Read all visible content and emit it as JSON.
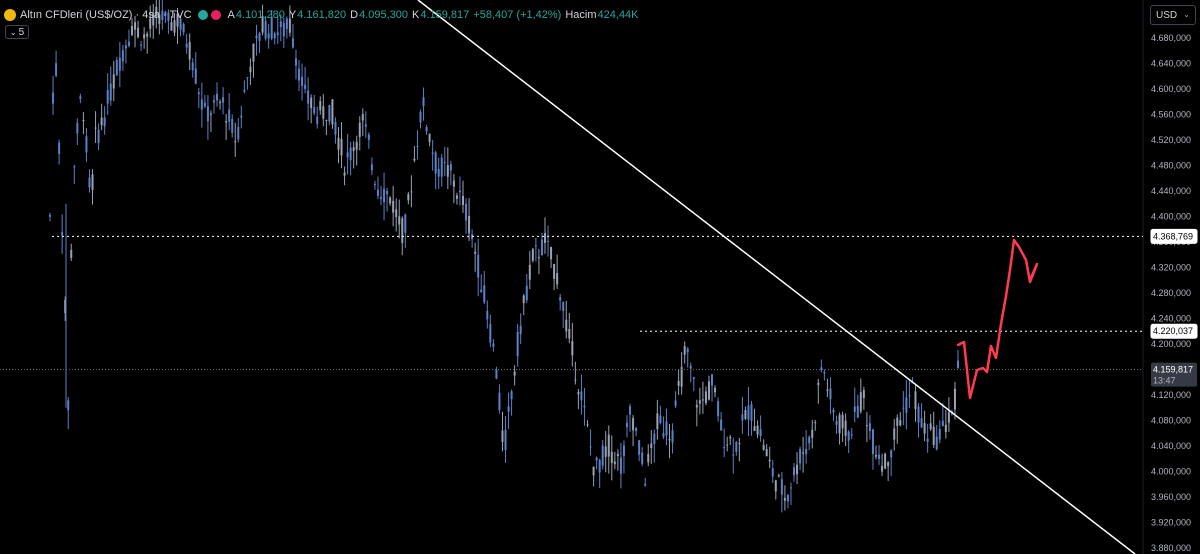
{
  "header": {
    "symbol": "Altın CFDleri (US$/OZ) · 4sa · TVC",
    "open_label": "A",
    "open": "4.101,280",
    "high_label": "Y",
    "high": "4.161,820",
    "low_label": "D",
    "low": "4.095,300",
    "close_label": "K",
    "close": "4.159,817",
    "change": "+58,407 (+1,42%)",
    "volume_label": "Hacim",
    "volume": "424,44K",
    "interval_badge": "5"
  },
  "currency": {
    "label": "USD",
    "chevron": "⌄"
  },
  "colors": {
    "background": "#000000",
    "candle": "#5b82c8",
    "candle_light": "#9aa3b3",
    "trendline": "#ffffff",
    "forecast": "#ff3b4e",
    "positive": "#26a69a"
  },
  "chart_data": {
    "type": "candlestick",
    "ylim": [
      3880,
      4700
    ],
    "y_ticks": [
      "4.680,000",
      "4.640,000",
      "4.600,000",
      "4.560,000",
      "4.520,000",
      "4.480,000",
      "4.440,000",
      "4.400,000",
      "4.360,000",
      "4.320,000",
      "4.280,000",
      "4.240,000",
      "4.200,000",
      "4.160,000",
      "4.120,000",
      "4.080,000",
      "4.040,000",
      "4.000,000",
      "3.960,000",
      "3.920,000",
      "3.880,000"
    ],
    "y_tick_values": [
      4680,
      4640,
      4600,
      4560,
      4520,
      4480,
      4440,
      4400,
      4360,
      4320,
      4280,
      4240,
      4200,
      4160,
      4120,
      4080,
      4040,
      4000,
      3960,
      3920,
      3880
    ],
    "levels": [
      {
        "value": 4368.769,
        "label": "4.368,769",
        "style": "dotted"
      },
      {
        "value": 4220.037,
        "label": "4.220,037",
        "style": "dotted"
      }
    ],
    "last_price": {
      "value": 4159.817,
      "label": "4.159,817",
      "countdown": "13:47"
    },
    "price_path": [
      [
        0,
        4400
      ],
      [
        1,
        4690
      ],
      [
        3,
        4330
      ],
      [
        4,
        4100
      ],
      [
        5,
        4460
      ],
      [
        7,
        4600
      ],
      [
        9,
        4420
      ],
      [
        10,
        4520
      ],
      [
        12,
        4560
      ],
      [
        15,
        4640
      ],
      [
        18,
        4700
      ],
      [
        21,
        4680
      ],
      [
        24,
        4720
      ],
      [
        26,
        4700
      ],
      [
        28,
        4710
      ],
      [
        31,
        4660
      ],
      [
        34,
        4560
      ],
      [
        38,
        4580
      ],
      [
        41,
        4520
      ],
      [
        44,
        4640
      ],
      [
        47,
        4700
      ],
      [
        51,
        4690
      ],
      [
        53,
        4700
      ],
      [
        56,
        4590
      ],
      [
        59,
        4560
      ],
      [
        62,
        4570
      ],
      [
        65,
        4480
      ],
      [
        69,
        4550
      ],
      [
        72,
        4450
      ],
      [
        75,
        4430
      ],
      [
        78,
        4370
      ],
      [
        82,
        4580
      ],
      [
        85,
        4480
      ],
      [
        88,
        4470
      ],
      [
        92,
        4400
      ],
      [
        95,
        4300
      ],
      [
        98,
        4180
      ],
      [
        100,
        4030
      ],
      [
        103,
        4200
      ],
      [
        106,
        4330
      ],
      [
        109,
        4360
      ],
      [
        112,
        4300
      ],
      [
        114,
        4220
      ],
      [
        117,
        4120
      ],
      [
        120,
        4000
      ],
      [
        123,
        4040
      ],
      [
        126,
        4010
      ],
      [
        128,
        4100
      ],
      [
        131,
        3990
      ],
      [
        134,
        4080
      ],
      [
        137,
        4060
      ],
      [
        140,
        4190
      ],
      [
        143,
        4100
      ],
      [
        146,
        4140
      ],
      [
        148,
        4060
      ],
      [
        151,
        4040
      ],
      [
        154,
        4100
      ],
      [
        156,
        4070
      ],
      [
        159,
        4000
      ],
      [
        162,
        3960
      ],
      [
        165,
        4020
      ],
      [
        168,
        4060
      ],
      [
        170,
        4170
      ],
      [
        173,
        4080
      ],
      [
        176,
        4060
      ],
      [
        179,
        4120
      ],
      [
        181,
        4050
      ],
      [
        184,
        4010
      ],
      [
        187,
        4080
      ],
      [
        190,
        4130
      ],
      [
        192,
        4070
      ],
      [
        195,
        4050
      ],
      [
        197,
        4070
      ],
      [
        199,
        4095
      ],
      [
        200,
        4159
      ]
    ],
    "trendline": [
      [
        418,
        0
      ],
      [
        1135,
        554
      ]
    ],
    "forecast_path": [
      [
        958,
        345
      ],
      [
        964,
        342
      ],
      [
        970,
        398
      ],
      [
        977,
        370
      ],
      [
        983,
        368
      ],
      [
        987,
        372
      ],
      [
        991,
        346
      ],
      [
        996,
        358
      ],
      [
        1001,
        324
      ],
      [
        1006,
        296
      ],
      [
        1010,
        270
      ],
      [
        1014,
        240
      ],
      [
        1019,
        247
      ],
      [
        1026,
        260
      ],
      [
        1030,
        282
      ],
      [
        1037,
        264
      ],
      [
        1030,
        280
      ]
    ]
  }
}
